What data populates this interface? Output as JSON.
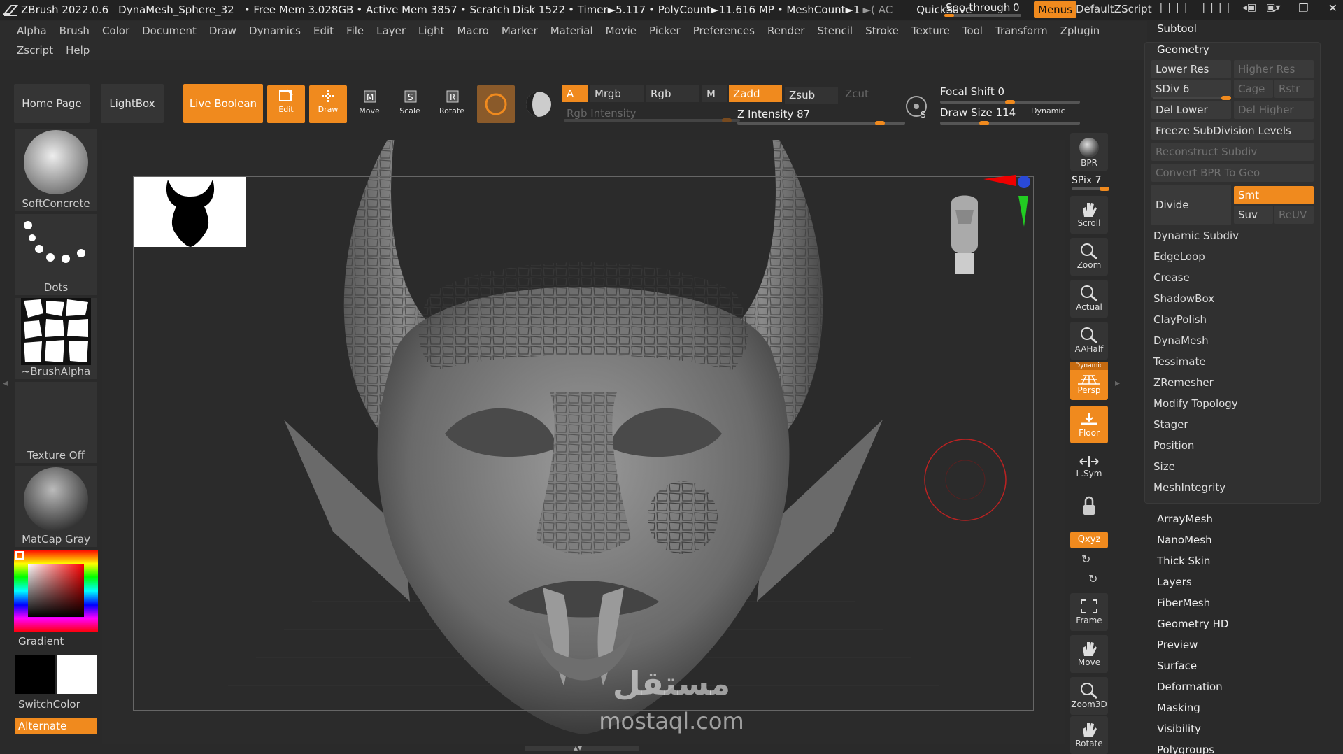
{
  "titlebar": {
    "app": "ZBrush 2022.0.6",
    "doc": "DynaMesh_Sphere_32",
    "free_mem": "• Free Mem 3.028GB",
    "active_mem": "• Active Mem 3857",
    "scratch": "• Scratch Disk 1522",
    "timer": "• Timer►5.117",
    "polycount": "• PolyCount►11.616 MP",
    "meshcount": "• MeshCount►1",
    "extra": "►( AC",
    "quicksave": "QuickSave",
    "seethrough": "See-through",
    "seethrough_value": "0",
    "menus": "Menus",
    "script": "DefaultZScript"
  },
  "menubar": {
    "row1": [
      "Alpha",
      "Brush",
      "Color",
      "Document",
      "Draw",
      "Dynamics",
      "Edit",
      "File",
      "Layer",
      "Light",
      "Macro",
      "Marker",
      "Material",
      "Movie",
      "Picker",
      "Preferences",
      "Render",
      "Stencil",
      "Stroke",
      "Texture",
      "Tool",
      "Transform",
      "Zplugin"
    ],
    "row2": [
      "Zscript",
      "Help"
    ]
  },
  "toolbar": {
    "home": "Home Page",
    "lightbox": "LightBox",
    "live_boolean": "Live Boolean",
    "edit": "Edit",
    "draw": "Draw",
    "move": "Move",
    "scale": "Scale",
    "rotate": "Rotate",
    "a": "A",
    "mrgb": "Mrgb",
    "rgb": "Rgb",
    "m": "M",
    "rgb_intensity": "Rgb Intensity",
    "zadd": "Zadd",
    "zsub": "Zsub",
    "zcut": "Zcut",
    "z_intensity": "Z Intensity 87",
    "focal_shift": "Focal Shift 0",
    "draw_size": "Draw Size 114",
    "dynamic": "Dynamic",
    "rgb_intensity_level": 0.95,
    "z_intensity_level": 0.87,
    "focal_shift_level": 0.5,
    "draw_size_level": 0.3
  },
  "leftpanel": {
    "brush": "SoftConcrete",
    "stroke": "Dots",
    "alpha": "~BrushAlpha",
    "texture": "Texture Off",
    "material": "MatCap Gray",
    "gradient": "Gradient",
    "switch": "SwitchColor",
    "alternate": "Alternate"
  },
  "rightcol": {
    "bpr": "BPR",
    "spix": "SPix 7",
    "scroll": "Scroll",
    "zoom": "Zoom",
    "actual": "Actual",
    "aahalf": "AAHalf",
    "dynamic": "Dynamic",
    "persp": "Persp",
    "floor": "Floor",
    "lsym": "L.Sym",
    "xyz": "Qxyz",
    "frame": "Frame",
    "move": "Move",
    "zoom3d": "Zoom3D",
    "rotate": "Rotate"
  },
  "rightpanel": {
    "subtool": "Subtool",
    "geometry": "Geometry",
    "lower_res": "Lower Res",
    "higher_res": "Higher Res",
    "sdiv": "SDiv 6",
    "cage": "Cage",
    "rstr": "Rstr",
    "del_lower": "Del Lower",
    "del_higher": "Del Higher",
    "freeze": "Freeze SubDivision Levels",
    "reconstruct": "Reconstruct Subdiv",
    "convert": "Convert BPR To Geo",
    "divide": "Divide",
    "smt": "Smt",
    "suv": "Suv",
    "reuv": "ReUV",
    "geo_items": [
      "Dynamic Subdiv",
      "EdgeLoop",
      "Crease",
      "ShadowBox",
      "ClayPolish",
      "DynaMesh",
      "Tessimate",
      "ZRemesher",
      "Modify Topology",
      "Stager",
      "Position",
      "Size",
      "MeshIntegrity"
    ],
    "sections": [
      "ArrayMesh",
      "NanoMesh",
      "Thick Skin",
      "Layers",
      "FiberMesh",
      "Geometry HD",
      "Preview",
      "Surface",
      "Deformation",
      "Masking",
      "Visibility",
      "Polygroups"
    ]
  },
  "watermark": {
    "arabic": "مستقل",
    "site": "mostaql.com"
  }
}
